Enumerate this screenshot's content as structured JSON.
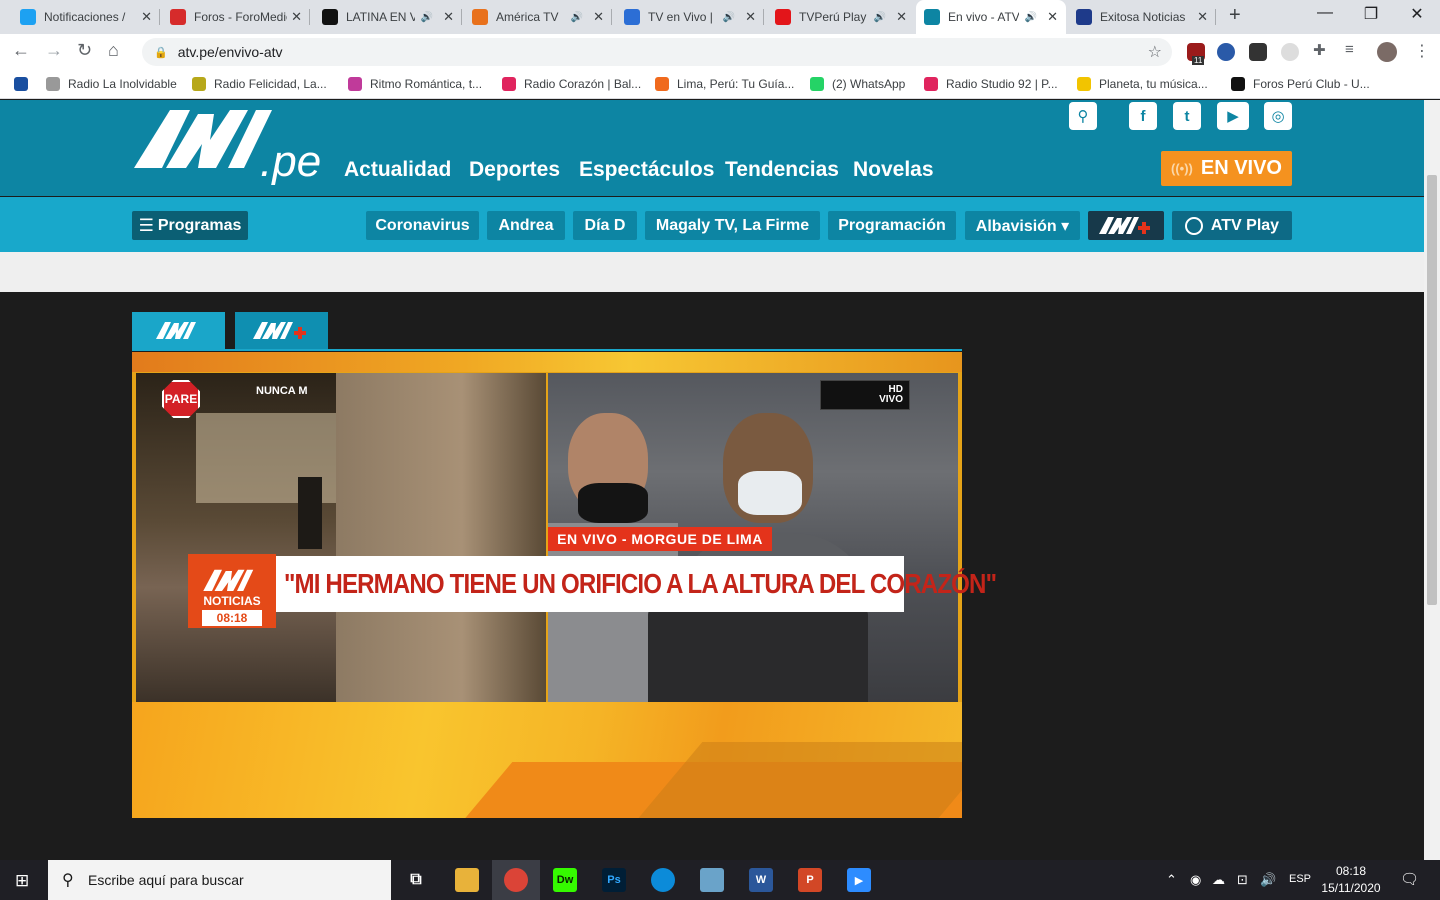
{
  "browser": {
    "tabs": [
      {
        "title": "Notificaciones /",
        "favicon": "twitter-icon",
        "color": "#1da1f2",
        "audio": false
      },
      {
        "title": "Foros - ForoMedios",
        "favicon": "foromedios-icon",
        "color": "#d62b2b",
        "audio": false
      },
      {
        "title": "LATINA EN VIVO",
        "favicon": "hd-icon",
        "color": "#111111",
        "audio": true
      },
      {
        "title": "América TV",
        "favicon": "globe-icon",
        "color": "#e8711c",
        "audio": true
      },
      {
        "title": "TV en Vivo |",
        "favicon": "p-icon",
        "color": "#2c6ed5",
        "audio": true
      },
      {
        "title": "TVPerú Play | TV",
        "favicon": "tvperu-icon",
        "color": "#e3151a",
        "audio": true
      },
      {
        "title": "En vivo - ATV",
        "favicon": "atv-icon",
        "color": "#0d85a3",
        "audio": true,
        "active": true
      },
      {
        "title": "Exitosa Noticias",
        "favicon": "exitosa-icon",
        "color": "#1e3a8a",
        "audio": false
      }
    ],
    "new_tab": "+",
    "window_buttons": {
      "minimize": "—",
      "restore": "❐",
      "close": "✕"
    },
    "url": "atv.pe/envivo-atv",
    "ext_badge": "11",
    "bookmarks": [
      {
        "label": "",
        "color": "#1a4fa0"
      },
      {
        "label": "Radio La Inolvidable",
        "color": "#999999"
      },
      {
        "label": "Radio Felicidad, La...",
        "color": "#b7a81a"
      },
      {
        "label": "Ritmo Romántica, t...",
        "color": "#c03a9a"
      },
      {
        "label": "Radio Corazón | Bal...",
        "color": "#e0245e"
      },
      {
        "label": "Lima, Perú: Tu Guía...",
        "color": "#f06a1d"
      },
      {
        "label": "(2) WhatsApp",
        "color": "#25d366"
      },
      {
        "label": "Radio Studio 92 | P...",
        "color": "#e0245e"
      },
      {
        "label": "Planeta, tu música...",
        "color": "#f2c400"
      },
      {
        "label": "Foros Perú Club - U...",
        "color": "#111111"
      }
    ]
  },
  "site": {
    "nav": [
      "Actualidad",
      "Deportes",
      "Espectáculos",
      "Tendencias",
      "Novelas"
    ],
    "live_button": "EN VIVO",
    "sub_nav": {
      "programas": "Programas",
      "items": [
        "Coronavirus",
        "Andrea",
        "Día D",
        "Magaly TV, La Firme",
        "Programación",
        "Albavisión ▾"
      ],
      "atv_play": "ATV Play"
    }
  },
  "video": {
    "live_tag": "EN VIVO - MORGUE DE LIMA",
    "headline": "\"MI HERMANO TIENE UN ORIFICIO A LA ALTURA DEL CORAZÓN\"",
    "badge_label": "NOTICIAS",
    "badge_time": "08:18",
    "hd_label": "HD",
    "vivo_label": "VIVO",
    "sign_text": "PARE",
    "wall_text": "NUNCA M"
  },
  "taskbar": {
    "search_placeholder": "Escribe aquí para buscar",
    "language": "ESP",
    "time": "08:18",
    "date": "15/11/2020"
  }
}
